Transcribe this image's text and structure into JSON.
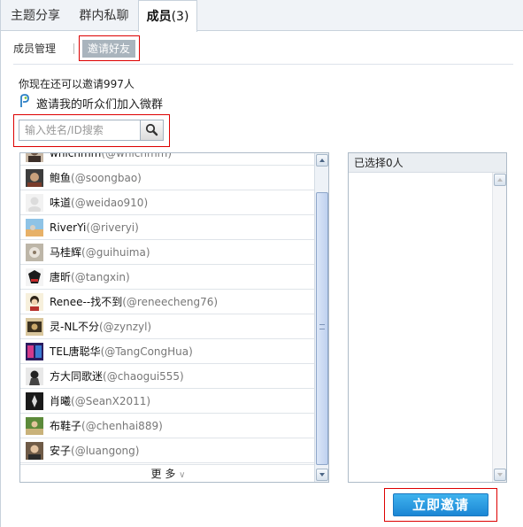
{
  "tabs": [
    {
      "label": "主题分享"
    },
    {
      "label": "群内私聊"
    },
    {
      "label": "成员",
      "count": "(3)"
    }
  ],
  "subnav": {
    "manage": "成员管理",
    "invite": "邀请好友"
  },
  "quota_text": "你现在还可以邀请997人",
  "invite_fans_text": "邀请我的听众们加入微群",
  "search": {
    "placeholder": "输入姓名/ID搜索"
  },
  "members": [
    {
      "name": "whichmm",
      "handle": "(@whichmm)"
    },
    {
      "name": "鲍鱼",
      "handle": "(@soongbao)"
    },
    {
      "name": "味道",
      "handle": "(@weidao910)"
    },
    {
      "name": "RiverYi",
      "handle": "(@riveryi)"
    },
    {
      "name": "马桂辉",
      "handle": "(@guihuima)"
    },
    {
      "name": "唐昕",
      "handle": "(@tangxin)"
    },
    {
      "name": "Renee--找不到",
      "handle": "(@reneecheng76)"
    },
    {
      "name": "灵-NL不分",
      "handle": "(@zynzyl)"
    },
    {
      "name": "TEL唐聪华",
      "handle": "(@TangCongHua)"
    },
    {
      "name": "方大同歌迷",
      "handle": "(@chaogui555)"
    },
    {
      "name": "肖曦",
      "handle": "(@SeanX2011)"
    },
    {
      "name": "布鞋子",
      "handle": "(@chenhai889)"
    },
    {
      "name": "安子",
      "handle": "(@luangong)"
    }
  ],
  "more_label": "更 多",
  "selected": {
    "header": "已选择0人"
  },
  "invite_button": "立即邀请",
  "colors": {
    "accent": "#1b86d4",
    "highlight": "#dd0000",
    "tab_active_bg": "#ffffff",
    "subnav_active": "#a9b4bd"
  }
}
